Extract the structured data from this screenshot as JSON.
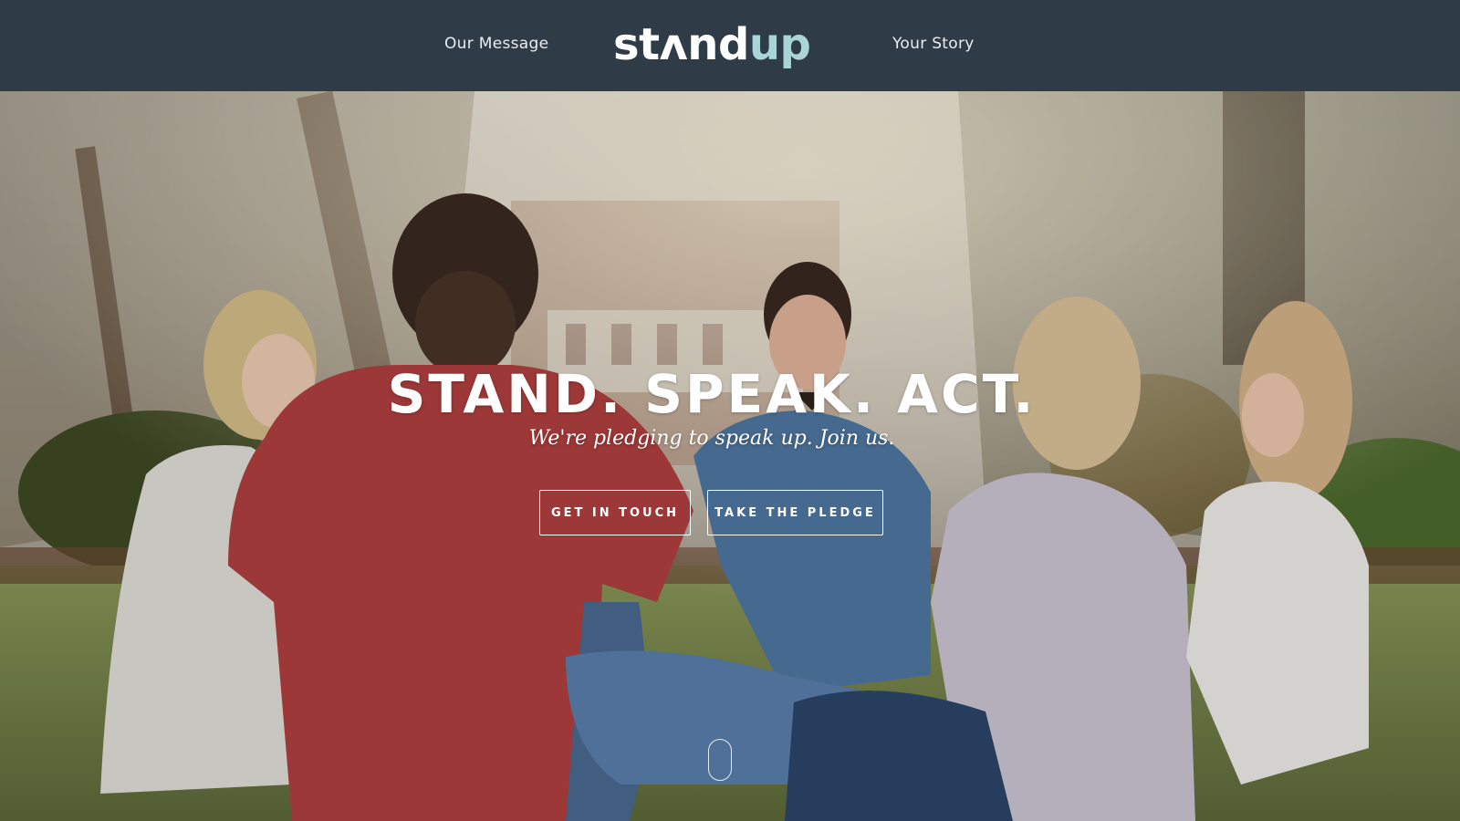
{
  "nav": {
    "left_link": "Our Message",
    "right_link": "Your Story",
    "logo_part_a": "stʌnd",
    "logo_part_b": "up"
  },
  "hero": {
    "headline": "STAND. SPEAK. ACT.",
    "subheadline": "We're pledging to speak up. Join us.",
    "primary_button": "GET IN TOUCH",
    "secondary_button": "TAKE THE PLEDGE"
  },
  "colors": {
    "navbar_bg": "#2f3b47",
    "logo_accent": "#a9d4d8",
    "text_light": "#ffffff"
  },
  "icons": {
    "scroll_indicator": "mouse-scroll-icon"
  }
}
